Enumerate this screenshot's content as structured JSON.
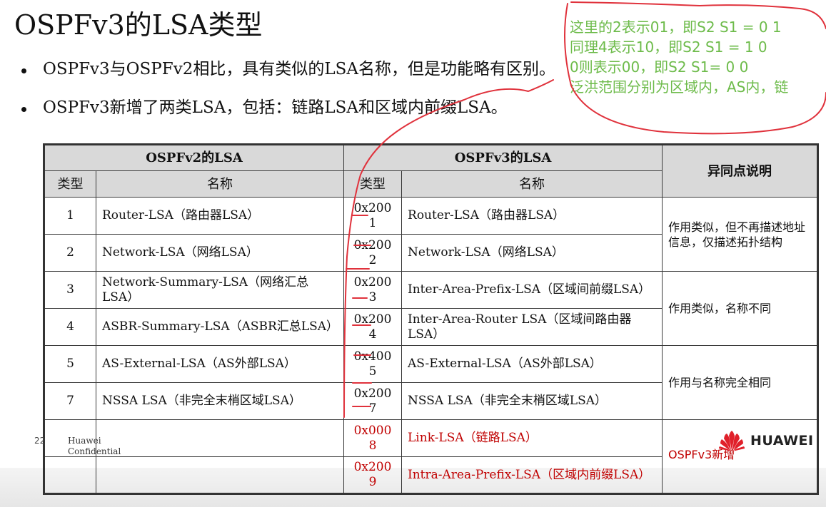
{
  "title": "OSPFv3的LSA类型",
  "bullets": [
    "OSPFv3与OSPFv2相比，具有类似的LSA名称，但是功能略有区别。",
    "OSPFv3新增了两类LSA，包括：链路LSA和区域内前缀LSA。"
  ],
  "annotation": {
    "lines": [
      "这里的2表示01，即S2 S1 = 0 1",
      "同理4表示10，即S2 S1 = 1 0",
      "0则表示00，即S2 S1= 0 0",
      "泛洪范围分别为区域内，AS内，链"
    ],
    "ink_color": "#e0323c",
    "text_color": "#6dbb4a"
  },
  "table": {
    "v2_header": "OSPFv2的LSA",
    "v3_header": "OSPFv3的LSA",
    "diff_header": "异同点说明",
    "col_type": "类型",
    "col_name": "名称",
    "rows": [
      {
        "v2_type": "1",
        "v2_name": "Router-LSA（路由器LSA）",
        "v3_code": "0x200",
        "v3_code2": "1",
        "v3_name": "Router-LSA（路由器LSA）"
      },
      {
        "v2_type": "2",
        "v2_name": "Network-LSA（网络LSA）",
        "v3_code": "0x200",
        "v3_code2": "2",
        "v3_name": "Network-LSA（网络LSA）"
      },
      {
        "v2_type": "3",
        "v2_name": "Network-Summary-LSA（网络汇总LSA）",
        "v3_code": "0x200",
        "v3_code2": "3",
        "v3_name": "Inter-Area-Prefix-LSA（区域间前缀LSA）"
      },
      {
        "v2_type": "4",
        "v2_name": "ASBR-Summary-LSA（ASBR汇总LSA）",
        "v3_code": "0x200",
        "v3_code2": "4",
        "v3_name": "Inter-Area-Router LSA（区域间路由器LSA）"
      },
      {
        "v2_type": "5",
        "v2_name": "AS-External-LSA（AS外部LSA）",
        "v3_code": "0x400",
        "v3_code2": "5",
        "v3_name": "AS-External-LSA（AS外部LSA）"
      },
      {
        "v2_type": "7",
        "v2_name": "NSSA LSA（非完全末梢区域LSA）",
        "v3_code": "0x200",
        "v3_code2": "7",
        "v3_name": "NSSA LSA（非完全末梢区域LSA）"
      },
      {
        "v2_type": "",
        "v2_name": "",
        "v3_code": "0x000",
        "v3_code2": "8",
        "v3_name": "Link-LSA（链路LSA）"
      },
      {
        "v2_type": "",
        "v2_name": "",
        "v3_code": "0x200",
        "v3_code2": "9",
        "v3_name": "Intra-Area-Prefix-LSA（区域内前缀LSA）"
      }
    ],
    "diff_notes": [
      "作用类似，但不再描述地址信息，仅描述拓扑结构",
      "作用类似，名称不同",
      "作用与名称完全相同",
      "OSPFv3新增"
    ],
    "new_color": "#c00000"
  },
  "footer": {
    "page": "22",
    "confidential_1": "Huawei",
    "confidential_2": "Confidential",
    "brand": "HUAWEI",
    "brand_color": "#e0202a"
  }
}
